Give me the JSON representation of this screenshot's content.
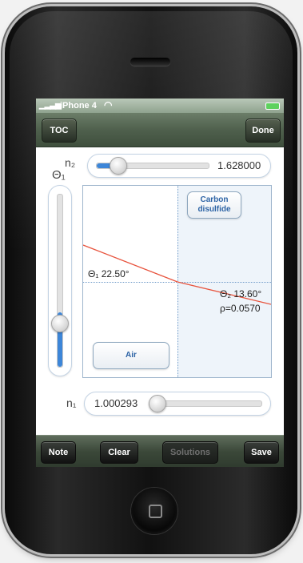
{
  "status": {
    "carrier": "iPhone 4"
  },
  "nav": {
    "left_button": "TOC",
    "right_button": "Done"
  },
  "labels": {
    "n2": "n₂",
    "theta1": "Θ₁",
    "n1": "n₁"
  },
  "sliders": {
    "n2": {
      "value_text": "1.628000",
      "fraction": 0.12
    },
    "theta1": {
      "fraction": 0.25
    },
    "n1": {
      "value_text": "1.000293",
      "fraction": 0.0
    }
  },
  "media": {
    "upper": "Carbon disulfide",
    "lower": "Air"
  },
  "annotations": {
    "incident_angle": "Θ₁ 22.50°",
    "refracted_angle": "Θ₂ 13.60°",
    "reflectance": "ρ=0.0570"
  },
  "toolbar": {
    "note": "Note",
    "clear": "Clear",
    "solutions": "Solutions",
    "save": "Save"
  },
  "colors": {
    "ray": "#e8543e",
    "slider_fill": "#3d86d8",
    "bar_tint": "#4f604d"
  }
}
